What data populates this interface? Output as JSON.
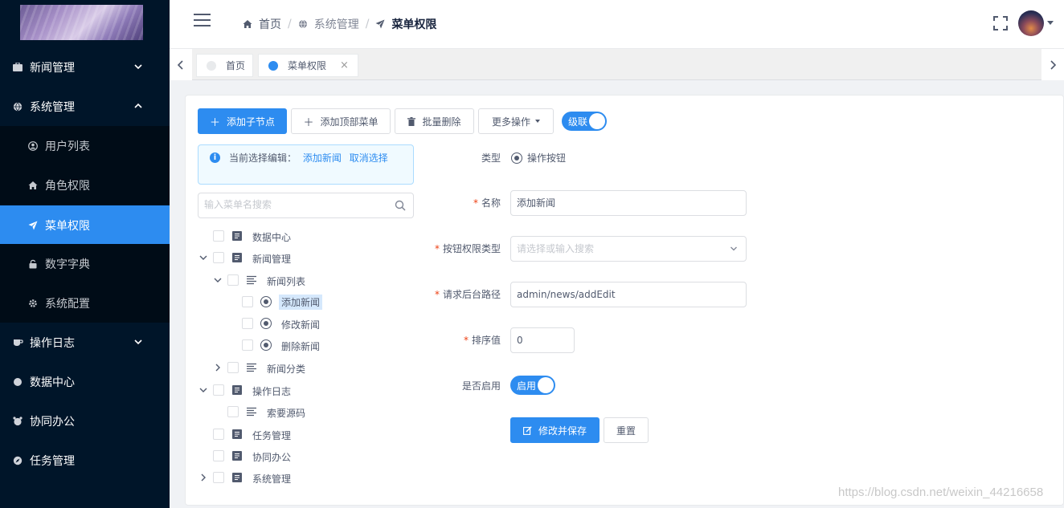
{
  "sidebar": {
    "items": [
      {
        "label": "新闻管理",
        "icon": "briefcase-icon"
      },
      {
        "label": "系统管理",
        "icon": "globe-icon"
      },
      {
        "label": "用户列表",
        "icon": "user-circle-icon"
      },
      {
        "label": "角色权限",
        "icon": "home-icon"
      },
      {
        "label": "菜单权限",
        "icon": "send-icon"
      },
      {
        "label": "数字字典",
        "icon": "lock-icon"
      },
      {
        "label": "系统配置",
        "icon": "gear-icon"
      },
      {
        "label": "操作日志",
        "icon": "coffee-icon"
      },
      {
        "label": "数据中心",
        "icon": "circle-icon"
      },
      {
        "label": "协同办公",
        "icon": "alarm-icon"
      },
      {
        "label": "任务管理",
        "icon": "compass-icon"
      }
    ]
  },
  "header": {
    "breadcrumb": [
      "首页",
      "系统管理",
      "菜单权限"
    ]
  },
  "tabs": [
    {
      "label": "首页",
      "active": false
    },
    {
      "label": "菜单权限",
      "active": true,
      "close": "×"
    }
  ],
  "toolbar": {
    "add_child": "添加子节点",
    "add_top": "添加顶部菜单",
    "batch_delete": "批量删除",
    "more": "更多操作",
    "cascade": "级联"
  },
  "alert": {
    "prefix": "当前选择编辑：",
    "selected": "添加新闻",
    "cancel": "取消选择"
  },
  "tree_search": {
    "placeholder": "输入菜单名搜索"
  },
  "tree": [
    {
      "label": "数据中心"
    },
    {
      "label": "新闻管理"
    },
    {
      "label": "新闻列表"
    },
    {
      "label": "添加新闻"
    },
    {
      "label": "修改新闻"
    },
    {
      "label": "删除新闻"
    },
    {
      "label": "新闻分类"
    },
    {
      "label": "操作日志"
    },
    {
      "label": "索要源码"
    },
    {
      "label": "任务管理"
    },
    {
      "label": "协同办公"
    },
    {
      "label": "系统管理"
    }
  ],
  "form": {
    "type_label": "类型",
    "type_value": "操作按钮",
    "name_label": "名称",
    "name_value": "添加新闻",
    "perm_type_label": "按钮权限类型",
    "perm_type_placeholder": "请选择或输入搜索",
    "path_label": "请求后台路径",
    "path_value": "admin/news/addEdit",
    "sort_label": "排序值",
    "sort_value": "0",
    "enable_label": "是否启用",
    "enable_value": "启用",
    "save_button": "修改并保存",
    "reset_button": "重置",
    "required_mark": "*"
  },
  "watermark": "https://blog.csdn.net/weixin_44216658",
  "colors": {
    "primary": "#2d8cf0",
    "sidebar": "#001529",
    "submenu": "#000c17"
  }
}
